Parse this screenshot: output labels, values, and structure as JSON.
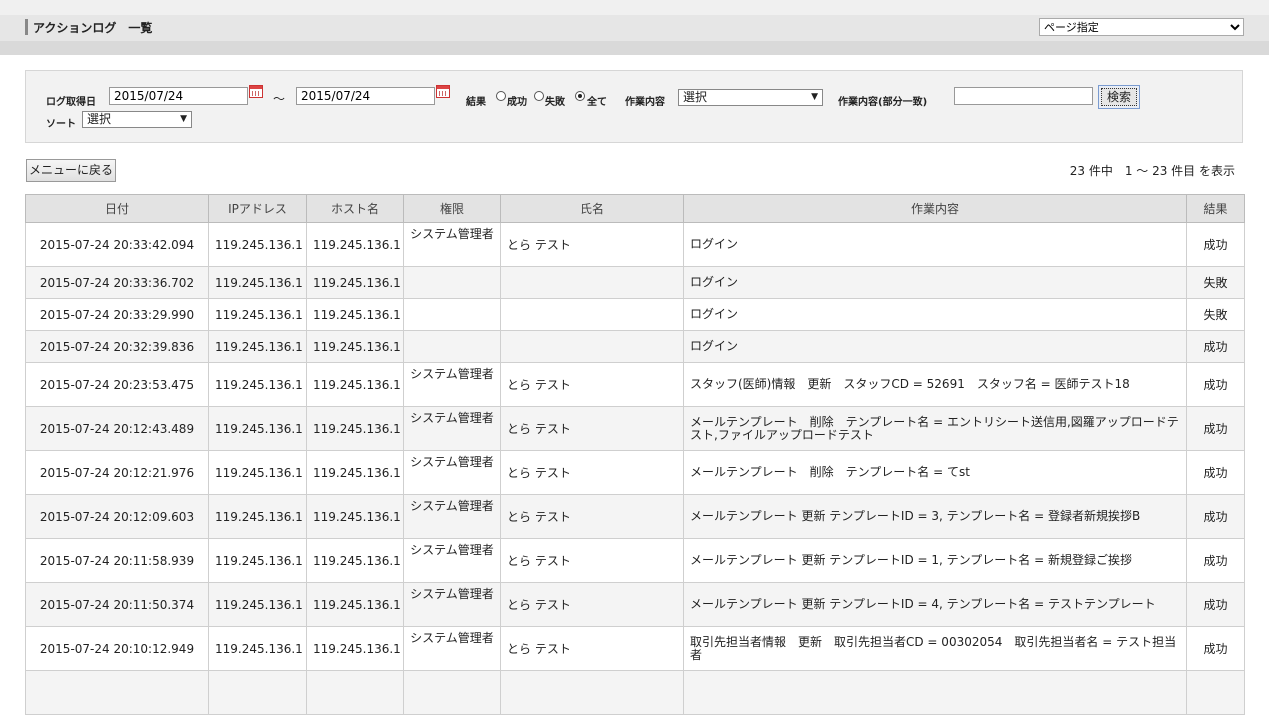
{
  "header": {
    "title": "アクションログ　一覧",
    "page_select": "ページ指定"
  },
  "search": {
    "log_date_label": "ログ取得日",
    "date_from": "2015/07/24",
    "tilde": "～",
    "date_to": "2015/07/24",
    "result_label": "結果",
    "result_options": [
      "成功",
      "失敗",
      "全て"
    ],
    "result_selected": "全て",
    "work_label": "作業内容",
    "work_select": "選択",
    "work_partial_label": "作業内容(部分一致)",
    "work_partial_value": "",
    "search_button": "検索",
    "sort_label": "ソート",
    "sort_select": "選択"
  },
  "toolbar": {
    "menu_back": "メニューに戻る",
    "count_text": "23 件中　1 ～ 23 件目 を表示"
  },
  "table": {
    "headers": [
      "日付",
      "IPアドレス",
      "ホスト名",
      "権限",
      "氏名",
      "作業内容",
      "結果"
    ],
    "rows": [
      {
        "date": "2015-07-24 20:33:42.094",
        "ip": "119.245.136.1",
        "host": "119.245.136.1",
        "role": "システム管理者",
        "name": "とら テスト",
        "work": "ログイン",
        "result": "成功"
      },
      {
        "date": "2015-07-24 20:33:36.702",
        "ip": "119.245.136.1",
        "host": "119.245.136.1",
        "role": "",
        "name": "",
        "work": "ログイン",
        "result": "失敗"
      },
      {
        "date": "2015-07-24 20:33:29.990",
        "ip": "119.245.136.1",
        "host": "119.245.136.1",
        "role": "",
        "name": "",
        "work": "ログイン",
        "result": "失敗"
      },
      {
        "date": "2015-07-24 20:32:39.836",
        "ip": "119.245.136.1",
        "host": "119.245.136.1",
        "role": "",
        "name": "",
        "work": "ログイン",
        "result": "成功"
      },
      {
        "date": "2015-07-24 20:23:53.475",
        "ip": "119.245.136.1",
        "host": "119.245.136.1",
        "role": "システム管理者",
        "name": "とら テスト",
        "work": "スタッフ(医師)情報　更新　スタッフCD = 52691　スタッフ名 = 医師テスト18",
        "result": "成功"
      },
      {
        "date": "2015-07-24 20:12:43.489",
        "ip": "119.245.136.1",
        "host": "119.245.136.1",
        "role": "システム管理者",
        "name": "とら テスト",
        "work": "メールテンプレート　削除　テンプレート名 = エントリシート送信用,図羅アップロードテスト,ファイルアップロードテスト",
        "result": "成功"
      },
      {
        "date": "2015-07-24 20:12:21.976",
        "ip": "119.245.136.1",
        "host": "119.245.136.1",
        "role": "システム管理者",
        "name": "とら テスト",
        "work": "メールテンプレート　削除　テンプレート名 = てst",
        "result": "成功"
      },
      {
        "date": "2015-07-24 20:12:09.603",
        "ip": "119.245.136.1",
        "host": "119.245.136.1",
        "role": "システム管理者",
        "name": "とら テスト",
        "work": "メールテンプレート 更新 テンプレートID = 3, テンプレート名 = 登録者新規挨拶B",
        "result": "成功"
      },
      {
        "date": "2015-07-24 20:11:58.939",
        "ip": "119.245.136.1",
        "host": "119.245.136.1",
        "role": "システム管理者",
        "name": "とら テスト",
        "work": "メールテンプレート 更新 テンプレートID = 1, テンプレート名 = 新規登録ご挨拶",
        "result": "成功"
      },
      {
        "date": "2015-07-24 20:11:50.374",
        "ip": "119.245.136.1",
        "host": "119.245.136.1",
        "role": "システム管理者",
        "name": "とら テスト",
        "work": "メールテンプレート 更新 テンプレートID = 4, テンプレート名 = テストテンプレート",
        "result": "成功"
      },
      {
        "date": "2015-07-24 20:10:12.949",
        "ip": "119.245.136.1",
        "host": "119.245.136.1",
        "role": "システム管理者",
        "name": "とら テスト",
        "work": "取引先担当者情報　更新　取引先担当者CD = 00302054　取引先担当者名 = テスト担当者",
        "result": "成功"
      },
      {
        "date": "",
        "ip": "",
        "host": "",
        "role": "",
        "name": "",
        "work": "",
        "result": ""
      }
    ]
  }
}
